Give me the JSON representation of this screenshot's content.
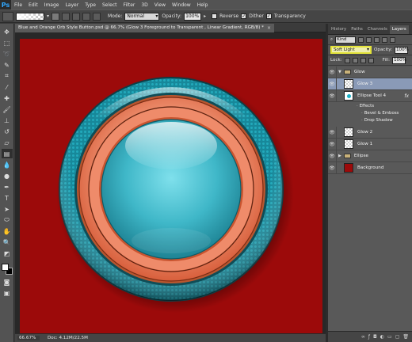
{
  "app": {
    "logo": "Ps"
  },
  "menu": [
    "File",
    "Edit",
    "Image",
    "Layer",
    "Type",
    "Select",
    "Filter",
    "3D",
    "View",
    "Window",
    "Help"
  ],
  "options_bar": {
    "mode_label": "Mode:",
    "mode_value": "Normal",
    "opacity_label": "Opacity:",
    "opacity_value": "100%",
    "reverse_label": "Reverse",
    "dither_label": "Dither",
    "transparency_label": "Transparency",
    "reverse_checked": false,
    "dither_checked": true,
    "transparency_checked": true
  },
  "document": {
    "tab_title": "Blue and Orange Orb Style Button.psd @ 66.7% (Glow 3    Foreground to Transparent , Linear Gradient, RGB/8) *",
    "close_glyph": "×",
    "canvas_color": "#9c0a0a"
  },
  "status": {
    "zoom": "66.67%",
    "doc_info": "Doc: 4.12M/22.5M"
  },
  "panel": {
    "tabs": [
      "History",
      "Paths",
      "Channels",
      "Layers"
    ],
    "active_tab": "Layers",
    "kind": "Kind",
    "blend_mode": "Soft Light",
    "opacity_label": "Opacity:",
    "opacity_value": "100%",
    "lock_label": "Lock:",
    "fill_label": "Fill:",
    "fill_value": "100%",
    "layers": [
      {
        "name": "Glow",
        "type": "group",
        "expanded": true
      },
      {
        "name": "Glow 3",
        "type": "layer",
        "selected": true
      },
      {
        "name": "Ellipse Tool 4",
        "type": "shape",
        "fx": "fx"
      },
      {
        "name": "Glow 2",
        "type": "layer"
      },
      {
        "name": "Glow 1",
        "type": "layer"
      },
      {
        "name": "Ellipse",
        "type": "group",
        "expanded": false
      },
      {
        "name": "Background",
        "type": "background"
      }
    ],
    "effects_label": "Effects",
    "effects": [
      "Bevel & Emboss",
      "Drop Shadow"
    ]
  },
  "colors": {
    "foreground": "#ffffff",
    "background": "#000000",
    "teal": "#1aa6b7",
    "orange": "#e9785a",
    "selection": "#8a9ab7"
  }
}
